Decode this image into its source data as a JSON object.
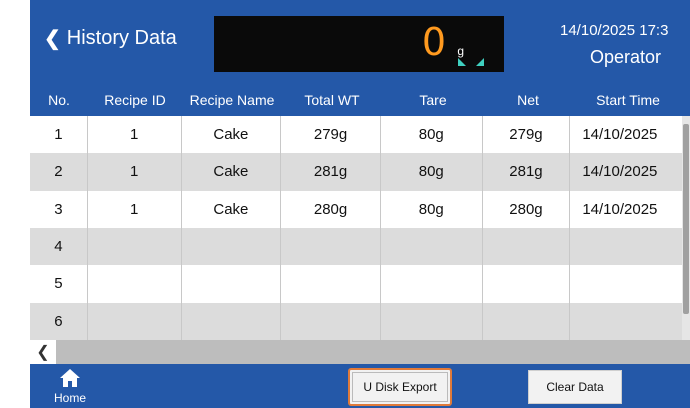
{
  "header": {
    "back_label": "History Data",
    "weight_value": "0",
    "weight_unit": "g",
    "datetime": "14/10/2025 17:3",
    "role": "Operator"
  },
  "table": {
    "columns": [
      "No.",
      "Recipe ID",
      "Recipe Name",
      "Total WT",
      "Tare",
      "Net",
      "Start Time"
    ],
    "rows": [
      [
        "1",
        "1",
        "Cake",
        "279g",
        "80g",
        "279g",
        "14/10/2025"
      ],
      [
        "2",
        "1",
        "Cake",
        "281g",
        "80g",
        "281g",
        "14/10/2025"
      ],
      [
        "3",
        "1",
        "Cake",
        "280g",
        "80g",
        "280g",
        "14/10/2025"
      ],
      [
        "4",
        "",
        "",
        "",
        "",
        "",
        ""
      ],
      [
        "5",
        "",
        "",
        "",
        "",
        "",
        ""
      ],
      [
        "6",
        "",
        "",
        "",
        "",
        "",
        ""
      ]
    ]
  },
  "footer": {
    "home_label": "Home",
    "export_label": "U Disk Export",
    "clear_label": "Clear Data"
  },
  "colors": {
    "primary": "#2458a8",
    "weight_display": "#ff9a1f",
    "export_outline": "#e07a3a"
  }
}
